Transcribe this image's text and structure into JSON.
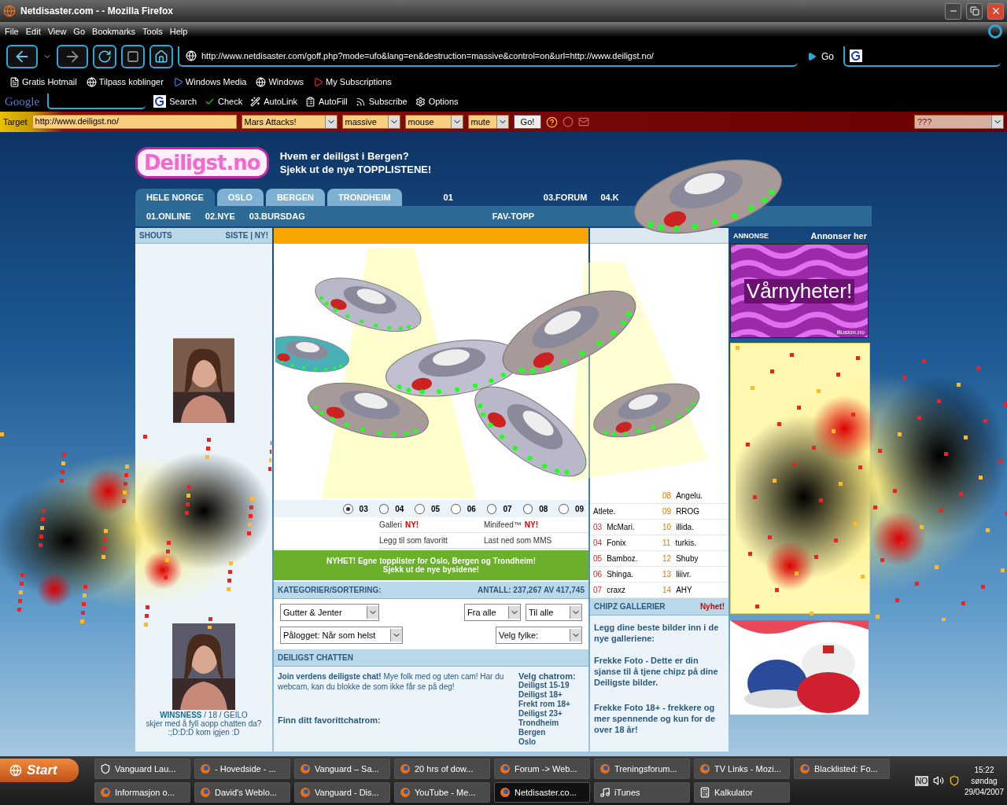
{
  "window": {
    "title": "Netdisaster.com - - Mozilla Firefox"
  },
  "menu": [
    "File",
    "Edit",
    "View",
    "Go",
    "Bookmarks",
    "Tools",
    "Help"
  ],
  "navigation": {
    "url": "http://www.netdisaster.com/goff.php?mode=ufo&lang=en&destruction=massive&control=on&url=http://www.deiligst.no/",
    "go": "Go"
  },
  "bookmarks": [
    {
      "label": "Gratis Hotmail",
      "kind": "page"
    },
    {
      "label": "Tilpass koblinger",
      "kind": "globe"
    },
    {
      "label": "Windows Media",
      "kind": "media"
    },
    {
      "label": "Windows",
      "kind": "globe"
    },
    {
      "label": "My Subscriptions",
      "kind": "video"
    }
  ],
  "google_toolbar": {
    "logo": "Google",
    "items": [
      {
        "label": "Search",
        "kind": "search"
      },
      {
        "label": "Check",
        "kind": "check"
      },
      {
        "label": "AutoLink",
        "kind": "wand"
      },
      {
        "label": "AutoFill",
        "kind": "fill"
      },
      {
        "label": "Subscribe",
        "kind": "rss"
      },
      {
        "label": "Options",
        "kind": "options"
      }
    ]
  },
  "disaster_bar": {
    "target_label": "Target",
    "target": "http://www.deiligst.no/",
    "selects": [
      "Mars Attacks!",
      "massive",
      "mouse",
      "mute"
    ],
    "go": "Go!",
    "extra_select": "???"
  },
  "site": {
    "logo": "Deiligst.no",
    "headline": [
      "Hvem er deiligst i Bergen?",
      "Sjekk ut de nye TOPPLISTENE!"
    ],
    "tabs": [
      {
        "label": "HELE NORGE",
        "selected": true
      },
      {
        "label": "OSLO",
        "selected": false
      },
      {
        "label": "BERGEN",
        "selected": false
      },
      {
        "label": "TRONDHEIM",
        "selected": false
      }
    ],
    "top_links": [
      "01",
      "03.FORUM",
      "04.K"
    ],
    "sub_links": [
      "01.ONLINE",
      "02.NYE",
      "03.BURSDAG"
    ],
    "sub_link_right": "FAV-TOPP",
    "shouts": {
      "title": "SHOUTS",
      "links": "SISTE | NY!",
      "user": "WINSNESS",
      "details": "/ 18 / GEILO",
      "comment": "skjer med å fyll aopp chatten da? :;D:D:D kom igjen :D"
    },
    "radios": [
      {
        "label": "03",
        "selected": true
      },
      {
        "label": "04",
        "selected": false
      },
      {
        "label": "05",
        "selected": false
      },
      {
        "label": "06",
        "selected": false
      },
      {
        "label": "07",
        "selected": false
      },
      {
        "label": "08",
        "selected": false
      },
      {
        "label": "09",
        "selected": false
      }
    ],
    "links": [
      {
        "label": "Galleri",
        "badge": "NY!"
      },
      {
        "label": "Minifeed™",
        "badge": "NY!"
      },
      {
        "label": "Legg til som favoritt"
      },
      {
        "label": "Last ned som MMS"
      }
    ],
    "banner": [
      "NYHET! Egne topplister for Oslo, Bergen og Trondheim!",
      "Sjekk ut de nye bysidene!"
    ],
    "categories": {
      "title": "KATEGORIER/SORTERING:",
      "count": "ANTALL: 237,267 AV 417,745",
      "selects": [
        "Gutter & Jenter",
        "Fra alle",
        "Til alle",
        "Pålogget: Når som helst",
        "Velg fylke:"
      ]
    },
    "chat": {
      "title": "DEILIGST CHATTEN",
      "intro": "**Join verdens deiligste chat!** Mye folk med og uten cam! Har du webcam, kan du blokke de som ikke får se på deg!",
      "find": "Finn ditt favorittchatrom:",
      "rooms_title": "Velg chatrom:",
      "rooms": [
        "Deiligst 15-19",
        "Deiligst 18+",
        "Frekt rom 18+",
        "Deiligst 23+",
        "Trondheim",
        "Bergen",
        "Oslo"
      ]
    },
    "top15": [
      {
        "right": {
          "rank": "08",
          "name": "Angelu."
        }
      },
      {
        "left": {
          "name": "Atlete."
        },
        "right": {
          "rank": "09",
          "name": "RROG"
        }
      },
      {
        "left": {
          "rank": "03",
          "name": "McMari."
        },
        "right": {
          "rank": "10",
          "name": "illida."
        }
      },
      {
        "left": {
          "rank": "04",
          "name": "Fonix"
        },
        "right": {
          "rank": "11",
          "name": "turkis."
        }
      },
      {
        "left": {
          "rank": "05",
          "name": "Bamboz."
        },
        "right": {
          "rank": "12",
          "name": "Shuby"
        }
      },
      {
        "left": {
          "rank": "06",
          "name": "Shinga."
        },
        "right": {
          "rank": "13",
          "name": "liiivr."
        }
      },
      {
        "left": {
          "rank": "07",
          "name": "craxz"
        },
        "right": {
          "rank": "14",
          "name": "AHY"
        }
      }
    ],
    "gallery": {
      "title": "CHIPZ GALLERIER",
      "badge": "Nyhet!",
      "paragraphs": [
        "Legg dine beste bilder inn i de nye galleriene:",
        "Frekke Foto - Dette er din sjanse til å tjene chipz på dine Deiligste bilder.",
        "Frekke Foto $^{}$**18+** - frekkere og mer spennende og kun for de over 18 år!"
      ]
    },
    "ads": {
      "label": "ANNONSE",
      "link": "Annonser her",
      "banner": "Vårnyheter!",
      "banner_site": "illusion.no"
    }
  },
  "taskbar": {
    "start": "Start",
    "buttons": [
      {
        "label": "Vanguard Lau...",
        "kind": "shield",
        "selected": false
      },
      {
        "label": "- Hovedside - ...",
        "kind": "firefox",
        "selected": false
      },
      {
        "label": "Vanguard – Sa...",
        "kind": "firefox",
        "selected": false
      },
      {
        "label": "20 hrs of dow...",
        "kind": "firefox",
        "selected": false
      },
      {
        "label": "Forum -> Web...",
        "kind": "firefox",
        "selected": false
      },
      {
        "label": "Treningsforum...",
        "kind": "firefox",
        "selected": false
      },
      {
        "label": "TV Links - Mozi...",
        "kind": "firefox",
        "selected": false
      },
      {
        "label": "Blacklisted: Fo...",
        "kind": "firefox",
        "selected": false
      },
      {
        "label": "Informasjon o...",
        "kind": "firefox",
        "selected": false
      },
      {
        "label": "David's Weblo...",
        "kind": "firefox",
        "selected": false
      },
      {
        "label": "Vanguard - Dis...",
        "kind": "firefox",
        "selected": false
      },
      {
        "label": "YouTube - Me...",
        "kind": "firefox",
        "selected": false
      },
      {
        "label": "Netdisaster.co...",
        "kind": "firefox",
        "selected": true
      },
      {
        "label": "iTunes",
        "kind": "music",
        "selected": false
      },
      {
        "label": "Kalkulator",
        "kind": "calculator",
        "selected": false
      }
    ],
    "language": "NO",
    "time": "15:22",
    "day": "søndag",
    "date": "29/04/2007"
  }
}
